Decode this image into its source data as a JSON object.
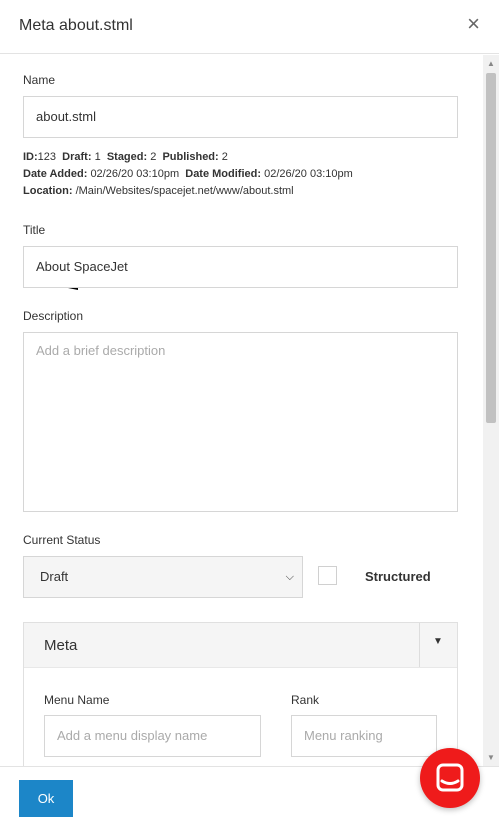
{
  "dialog": {
    "title": "Meta about.stml",
    "close_glyph": "×"
  },
  "name": {
    "label": "Name",
    "value": "about.stml"
  },
  "info": {
    "id_label": "ID:",
    "id_value": "123",
    "draft_label": "Draft:",
    "draft_value": "1",
    "staged_label": "Staged:",
    "staged_value": "2",
    "published_label": "Published:",
    "published_value": "2",
    "date_added_label": "Date Added:",
    "date_added_value": "02/26/20 03:10pm",
    "date_modified_label": "Date Modified:",
    "date_modified_value": "02/26/20 03:10pm",
    "location_label": "Location:",
    "location_value": "/Main/Websites/spacejet.net/www/about.stml"
  },
  "title_field": {
    "label": "Title",
    "value": "About SpaceJet"
  },
  "description": {
    "label": "Description",
    "placeholder": "Add a brief description",
    "value": ""
  },
  "status": {
    "label": "Current Status",
    "selected": "Draft",
    "structured_label": "Structured",
    "structured_checked": false
  },
  "meta_panel": {
    "title": "Meta",
    "menu_name_label": "Menu Name",
    "menu_name_placeholder": "Add a menu display name",
    "rank_label": "Rank",
    "rank_placeholder": "Menu ranking"
  },
  "footer": {
    "ok_label": "Ok"
  },
  "colors": {
    "primary": "#1c86c8",
    "chat_bubble": "#ef1b1b"
  },
  "icons": [
    "close-icon",
    "arrow-annotation-icon",
    "chevron-down-icon",
    "caret-down-icon",
    "chat-icon"
  ]
}
